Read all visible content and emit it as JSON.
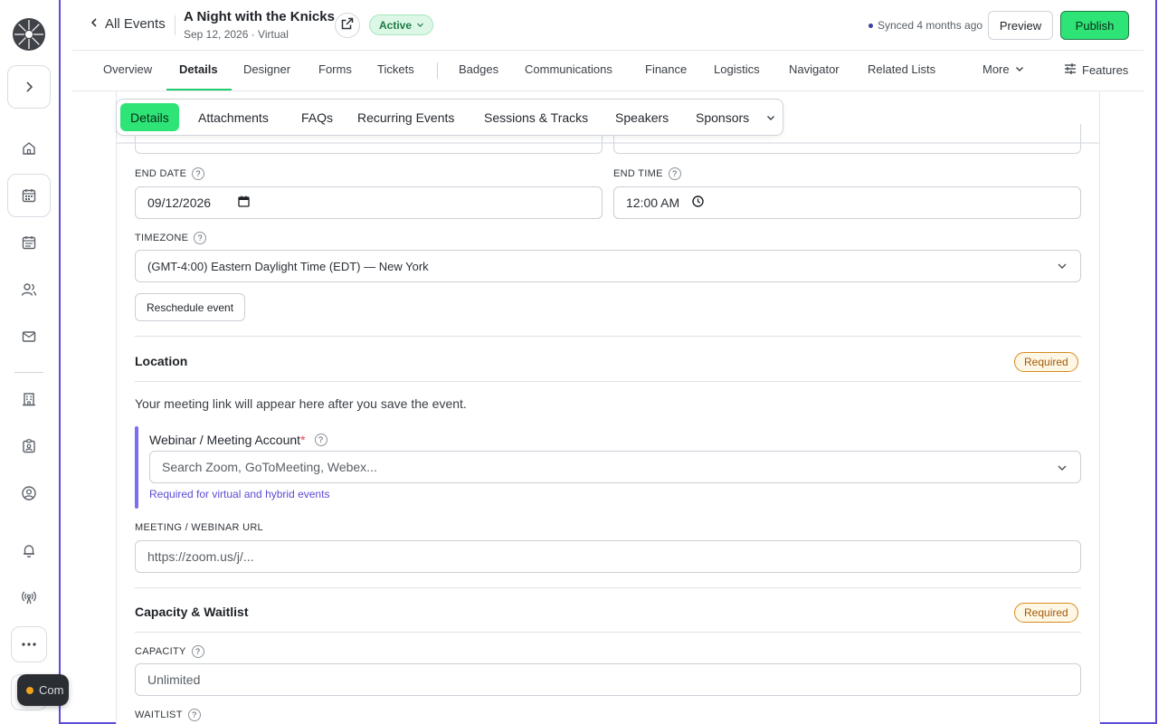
{
  "header": {
    "back_label": "All Events",
    "event_title": "A Night with the Knicks",
    "event_subtitle": "Sep 12, 2026 · Virtual",
    "status": "Active",
    "synced": "Synced 4 months ago",
    "preview_label": "Preview",
    "publish_label": "Publish"
  },
  "tabs": {
    "items": [
      "Overview",
      "Details",
      "Designer",
      "Forms",
      "Tickets",
      "Badges",
      "Communications",
      "Finance",
      "Logistics",
      "Navigator",
      "Related Lists"
    ],
    "active": "Details",
    "more_label": "More",
    "features_label": "Features"
  },
  "subtabs": {
    "items": [
      "Details",
      "Attachments",
      "FAQs",
      "Recurring Events",
      "Sessions & Tracks",
      "Speakers",
      "Sponsors"
    ],
    "active": "Details"
  },
  "form": {
    "end_date_label": "END DATE",
    "end_date_value": "09/12/2026",
    "end_time_label": "END TIME",
    "end_time_value": "12:00 AM",
    "timezone_label": "TIMEZONE",
    "timezone_value": "(GMT-4:00) Eastern Daylight Time (EDT) — New York",
    "reschedule_label": "Reschedule event",
    "location_title": "Location",
    "required_badge": "Required",
    "location_hint": "Your meeting link will appear here after you save the event.",
    "webinar_label": "Webinar / Meeting Account",
    "webinar_required_mark": "*",
    "webinar_placeholder": "Search Zoom, GoToMeeting, Webex...",
    "webinar_help": "Required for virtual and hybrid events",
    "meeting_url_label": "MEETING / WEBINAR URL",
    "meeting_url_placeholder": "https://zoom.us/j/...",
    "capacity_title": "Capacity & Waitlist",
    "capacity_label": "CAPACITY",
    "capacity_placeholder": "Unlimited",
    "waitlist_label": "WAITLIST",
    "help_mark": "?"
  },
  "chip": {
    "label": "Com"
  },
  "icons": {
    "rail": [
      "logo-icon",
      "expand-icon",
      "home-icon",
      "calendar-icon",
      "calendar-list-icon",
      "people-icon",
      "mail-icon",
      "building-icon",
      "badge-icon",
      "user-circle-icon",
      "bell-icon",
      "broadcast-icon",
      "more-icon"
    ]
  },
  "colors": {
    "accent_green": "#2ee477",
    "frame_purple": "#5b4cd6",
    "required_orange": "#d58a1d",
    "help_purple": "#5b4cd6"
  }
}
